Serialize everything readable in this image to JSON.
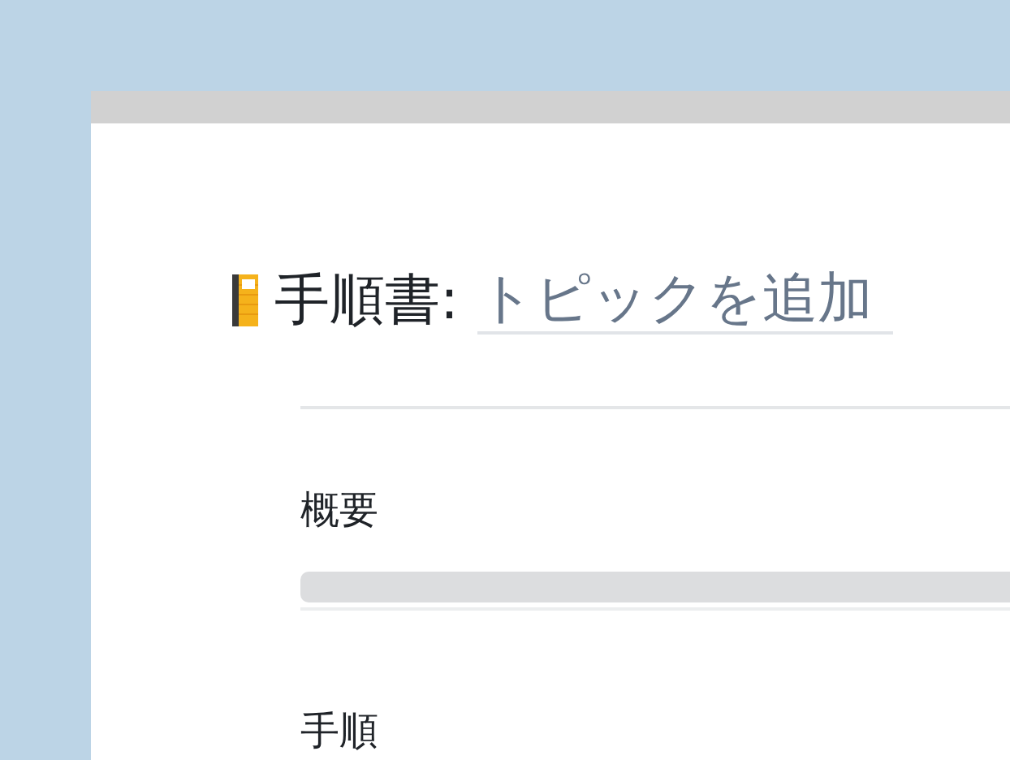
{
  "title": {
    "label": "手順書:",
    "placeholder": "トピックを追加"
  },
  "sections": [
    {
      "heading": "概要",
      "kind": "editor"
    },
    {
      "heading": "手順",
      "kind": "heading"
    }
  ]
}
